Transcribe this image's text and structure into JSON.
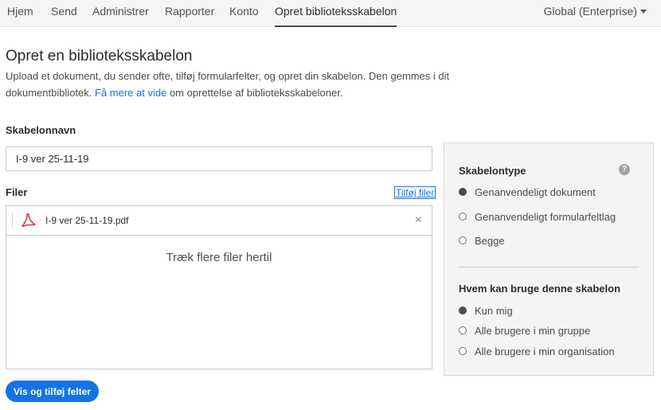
{
  "nav": {
    "items": [
      {
        "label": "Hjem",
        "active": false
      },
      {
        "label": "Send",
        "active": false
      },
      {
        "label": "Administrer",
        "active": false
      },
      {
        "label": "Rapporter",
        "active": false
      },
      {
        "label": "Konto",
        "active": false
      },
      {
        "label": "Opret biblioteksskabelon",
        "active": true
      }
    ],
    "account": "Global (Enterprise)"
  },
  "header": {
    "title": "Opret en biblioteksskabelon",
    "desc_before": "Upload et dokument, du sender ofte, tilføj formularfelter, og opret din skabelon. Den gemmes i dit dokumentbibliotek. ",
    "desc_link": "Få mere at vide",
    "desc_after": " om oprettelse af biblioteksskabeloner."
  },
  "form": {
    "name_label": "Skabelonnavn",
    "name_value": "I-9 ver 25-11-19",
    "files_label": "Filer",
    "add_files": "Tilføj filer",
    "files": [
      {
        "name": "I-9 ver 25-11-19.pdf",
        "icon": "pdf-icon"
      }
    ],
    "remove_glyph": "×",
    "drop_text": "Træk flere filer hertil",
    "submit": "Vis og tilføj felter"
  },
  "panel": {
    "type_title": "Skabelontype",
    "help_glyph": "?",
    "type_options": [
      {
        "label": "Genanvendeligt dokument",
        "checked": true
      },
      {
        "label": "Genanvendeligt formularfeltlag",
        "checked": false
      },
      {
        "label": "Begge",
        "checked": false
      }
    ],
    "who_title": "Hvem kan bruge denne skabelon",
    "who_options": [
      {
        "label": "Kun mig",
        "checked": true
      },
      {
        "label": "Alle brugere i min gruppe",
        "checked": false
      },
      {
        "label": "Alle brugere i min organisation",
        "checked": false
      }
    ]
  },
  "colors": {
    "accent": "#1473e6",
    "pdf_red": "#d7373f"
  }
}
